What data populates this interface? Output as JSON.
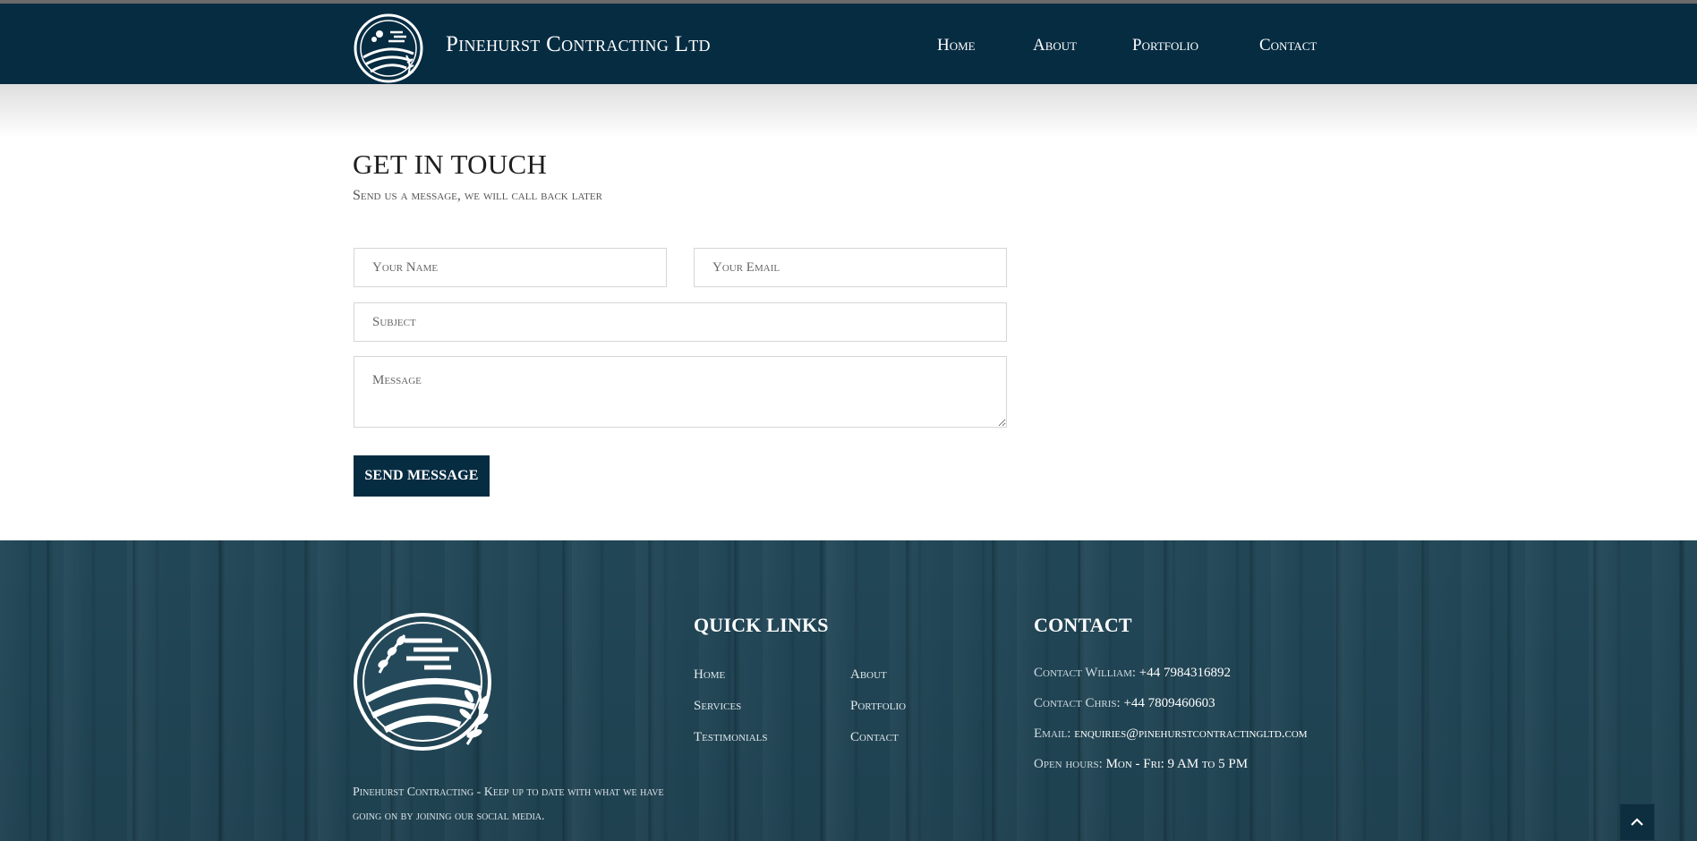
{
  "header": {
    "brand_name": "Pinehurst Contracting Ltd",
    "nav": [
      {
        "label": "Home"
      },
      {
        "label": "About"
      },
      {
        "label": "Portfolio"
      },
      {
        "label": "Contact"
      }
    ]
  },
  "contact_form": {
    "title": "GET IN TOUCH",
    "subtitle": "Send us a message, we will call back later",
    "name_placeholder": "Your Name",
    "email_placeholder": "Your Email",
    "subject_placeholder": "Subject",
    "message_placeholder": "Message",
    "send_label": "SEND MESSAGE"
  },
  "footer": {
    "about_text": "Pinehurst Contracting - Keep up to date with what we have going on by joining our social media.",
    "quick_links": {
      "heading": "QUICK LINKS",
      "left": [
        "Home",
        "Services",
        "Testimonials"
      ],
      "right": [
        "About",
        "Portfolio",
        "Contact"
      ]
    },
    "contact": {
      "heading": "CONTACT",
      "lines": [
        {
          "label": "Contact William:",
          "value": "+44 7984316892"
        },
        {
          "label": "Contact Chris:",
          "value": "+44 7809460603"
        },
        {
          "label": "Email:",
          "value": "enquiries@pinehurstcontractingltd.com"
        },
        {
          "label": "Open hours:",
          "value": "Mon - Fri: 9 AM to 5 PM"
        }
      ]
    }
  },
  "colors": {
    "navy": "#062c42",
    "footer_wood": "#234a5b"
  },
  "icons": {
    "brand": "landscape-logo-icon",
    "scroll_top": "chevron-up-icon"
  }
}
